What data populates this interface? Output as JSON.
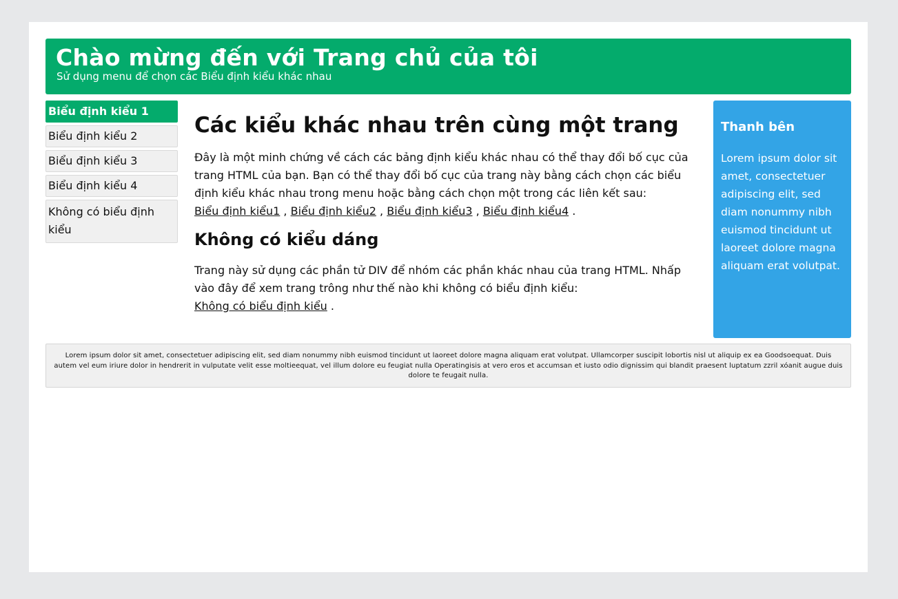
{
  "header": {
    "title": "Chào mừng đến với Trang chủ của tôi",
    "subtitle": "Sử dụng menu để chọn các Biểu định kiểu khác nhau"
  },
  "menu": {
    "items": [
      {
        "label": "Biểu định kiểu 1",
        "active": true
      },
      {
        "label": "Biểu định kiểu 2",
        "active": false
      },
      {
        "label": "Biểu định kiểu 3",
        "active": false
      },
      {
        "label": "Biểu định kiểu 4",
        "active": false
      },
      {
        "label": "Không có biểu định kiểu",
        "active": false
      }
    ]
  },
  "main": {
    "heading": "Các kiểu khác nhau trên cùng một trang",
    "intro": "Đây là một minh chứng về cách các bảng định kiểu khác nhau có thể thay đổi bố cục của trang HTML của bạn. Bạn có thể thay đổi bố cục của trang này bằng cách chọn các biểu định kiểu khác nhau trong menu hoặc bằng cách chọn một trong các liên kết sau:",
    "links": [
      "Biểu định kiểu1",
      "Biểu định kiểu2",
      "Biểu định kiểu3",
      "Biểu định kiểu4"
    ],
    "link_separator": " , ",
    "link_end": " .",
    "subheading": "Không có kiểu dáng",
    "body": "Trang này sử dụng các phần tử DIV để nhóm các phần khác nhau của trang HTML. Nhấp vào đây để xem trang trông như thế nào khi không có biểu định kiểu:",
    "nostyle_link": "Không có biểu định kiểu",
    "nostyle_end": " ."
  },
  "sidebar": {
    "title": "Thanh bên",
    "text": "Lorem ipsum dolor sit amet, consectetuer adipiscing elit, sed diam nonummy nibh euismod tincidunt ut laoreet dolore magna aliquam erat volutpat."
  },
  "footer": {
    "text": "Lorem ipsum dolor sit amet, consectetuer adipiscing elit, sed diam nonummy nibh euismod tincidunt ut laoreet dolore magna aliquam erat volutpat. Ullamcorper suscipit lobortis nisl ut aliquip ex ea Goodsoequat. Duis autem vel eum iriure dolor in hendrerit in vulputate velit esse moltieequat, vel illum dolore eu feugiat nulla Operatingisis at vero eros et accumsan et iusto odio dignissim qui blandit praesent luptatum zzril xóanit augue duis dolore te feugait nulla."
  },
  "colors": {
    "page_bg": "#e7e8ea",
    "header_bg": "#04ab6c",
    "active_menu_bg": "#04ab6c",
    "sidebar_bg": "#33a4e6",
    "menu_bg": "#f0f0f0"
  }
}
